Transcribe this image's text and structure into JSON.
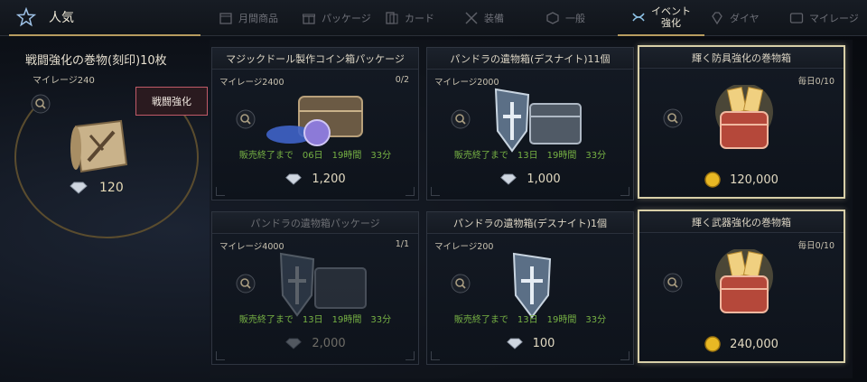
{
  "nav": {
    "popular_label": "人気",
    "tabs": [
      {
        "label": "月間商品",
        "icon": "calendar-icon"
      },
      {
        "label": "パッケージ",
        "icon": "gift-icon"
      },
      {
        "label": "カード",
        "icon": "card-icon"
      },
      {
        "label": "装備",
        "icon": "swords-icon"
      },
      {
        "label": "一般",
        "icon": "cube-icon"
      },
      {
        "label_line1": "イベント",
        "label_line2": "強化",
        "icon": "ribbon-icon",
        "active": true
      },
      {
        "label": "ダイヤ",
        "icon": "diamond-icon"
      },
      {
        "label": "マイレージ",
        "icon": "mileage-icon"
      }
    ]
  },
  "featured": {
    "title": "戦闘強化の巻物(刻印)10枚",
    "mileage": "マイレージ240",
    "tag": "戦闘強化",
    "price": "120",
    "currency_icon": "diamond-currency-icon"
  },
  "cards": [
    {
      "title": "マジックドール製作コイン箱パッケージ",
      "mileage": "マイレージ2400",
      "limit": "0/2",
      "sale": "販売終了まで　06日　19時間　33分",
      "price": "1,200",
      "currency": "diamond",
      "art": "coin-chest"
    },
    {
      "title": "パンドラの遺物箱(デスナイト)11個",
      "mileage": "マイレージ2000",
      "limit": "",
      "sale": "販売終了まで　13日　19時間　33分",
      "price": "1,000",
      "currency": "diamond",
      "art": "shield-chest"
    },
    {
      "title": "輝く防具強化の巻物箱",
      "mileage": "",
      "limit": "毎日0/10",
      "sale": "",
      "price": "120,000",
      "currency": "gold",
      "art": "red-chest-scrolls"
    },
    {
      "title": "パンドラの遺物箱パッケージ",
      "mileage": "マイレージ4000",
      "limit": "1/1",
      "sale": "販売終了まで　13日　19時間　33分",
      "price": "2,000",
      "currency": "diamond",
      "art": "shield-chest",
      "dim": true
    },
    {
      "title": "パンドラの遺物箱(デスナイト)1個",
      "mileage": "マイレージ200",
      "limit": "",
      "sale": "販売終了まで　13日　19時間　33分",
      "price": "100",
      "currency": "diamond",
      "art": "shield"
    },
    {
      "title": "輝く武器強化の巻物箱",
      "mileage": "",
      "limit": "毎日0/10",
      "sale": "",
      "price": "240,000",
      "currency": "gold",
      "art": "red-chest-scrolls"
    }
  ],
  "colors": {
    "accent_gold": "#b79c5f",
    "sale_green": "#77b244",
    "tag_border": "#c05a68",
    "highlight_border": "#d8cfa8"
  }
}
